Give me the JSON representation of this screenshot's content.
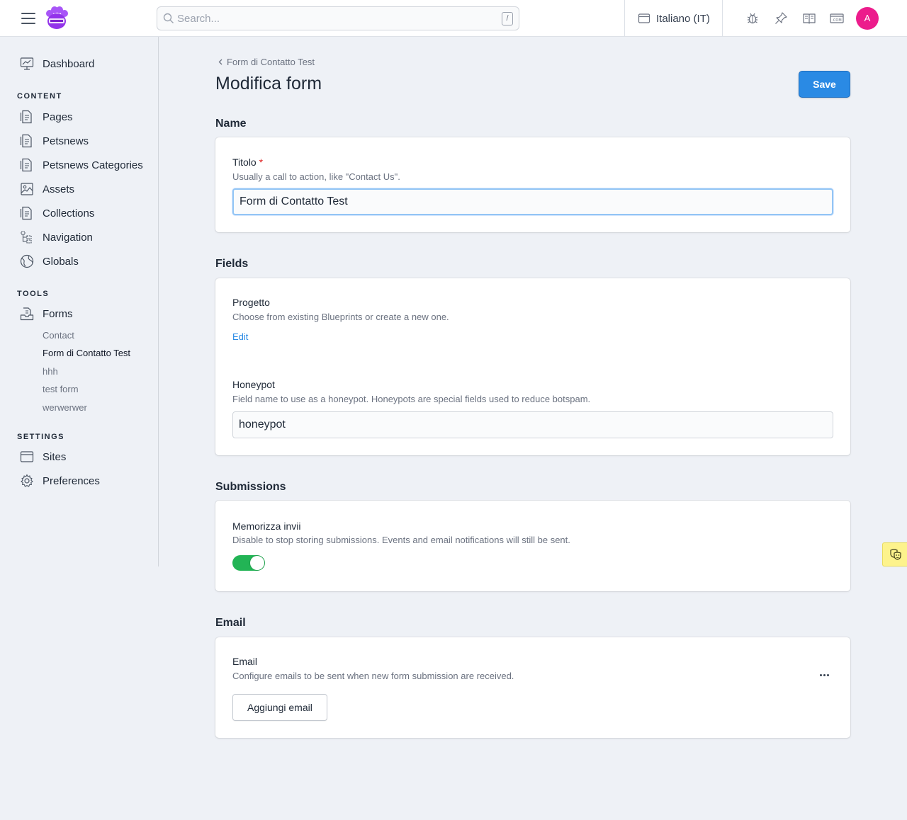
{
  "topbar": {
    "search_placeholder": "Search...",
    "search_shortcut": "/",
    "site_label": "Italiano (IT)",
    "avatar_initial": "A",
    "icons": [
      "menu-icon",
      "logo-icon",
      "search-icon",
      "sites-icon",
      "bug-icon",
      "pin-icon",
      "book-icon",
      "domain-icon"
    ]
  },
  "sidebar": {
    "dashboard": "Dashboard",
    "content_heading": "CONTENT",
    "content_items": [
      "Pages",
      "Petsnews",
      "Petsnews Categories",
      "Assets",
      "Collections",
      "Navigation",
      "Globals"
    ],
    "tools_heading": "TOOLS",
    "forms": "Forms",
    "forms_children": [
      "Contact",
      "Form di Contatto Test",
      "hhh",
      "test form",
      "werwerwer"
    ],
    "settings_heading": "SETTINGS",
    "settings_items": [
      "Sites",
      "Preferences"
    ]
  },
  "main": {
    "breadcrumb": "Form di Contatto Test",
    "title": "Modifica form",
    "save_label": "Save",
    "name_section": {
      "heading": "Name",
      "label": "Titolo",
      "required_mark": "*",
      "help": "Usually a call to action, like \"Contact Us\".",
      "value": "Form di Contatto Test"
    },
    "fields_section": {
      "heading": "Fields",
      "blueprint_label": "Progetto",
      "blueprint_help": "Choose from existing Blueprints or create a new one.",
      "blueprint_link": "Edit",
      "honeypot_label": "Honeypot",
      "honeypot_help": "Field name to use as a honeypot. Honeypots are special fields used to reduce botspam.",
      "honeypot_value": "honeypot"
    },
    "submissions_section": {
      "heading": "Submissions",
      "label": "Memorizza invii",
      "help": "Disable to stop storing submissions. Events and email notifications will still be sent.",
      "toggle_on": true
    },
    "email_section": {
      "heading": "Email",
      "label": "Email",
      "help": "Configure emails to be sent when new form submission are received.",
      "add_label": "Aggiungi email"
    }
  },
  "colors": {
    "accent": "#2a8ae4",
    "toggle_on": "#22b455",
    "avatar": "#ec1c8c",
    "background": "#eef1f6"
  }
}
